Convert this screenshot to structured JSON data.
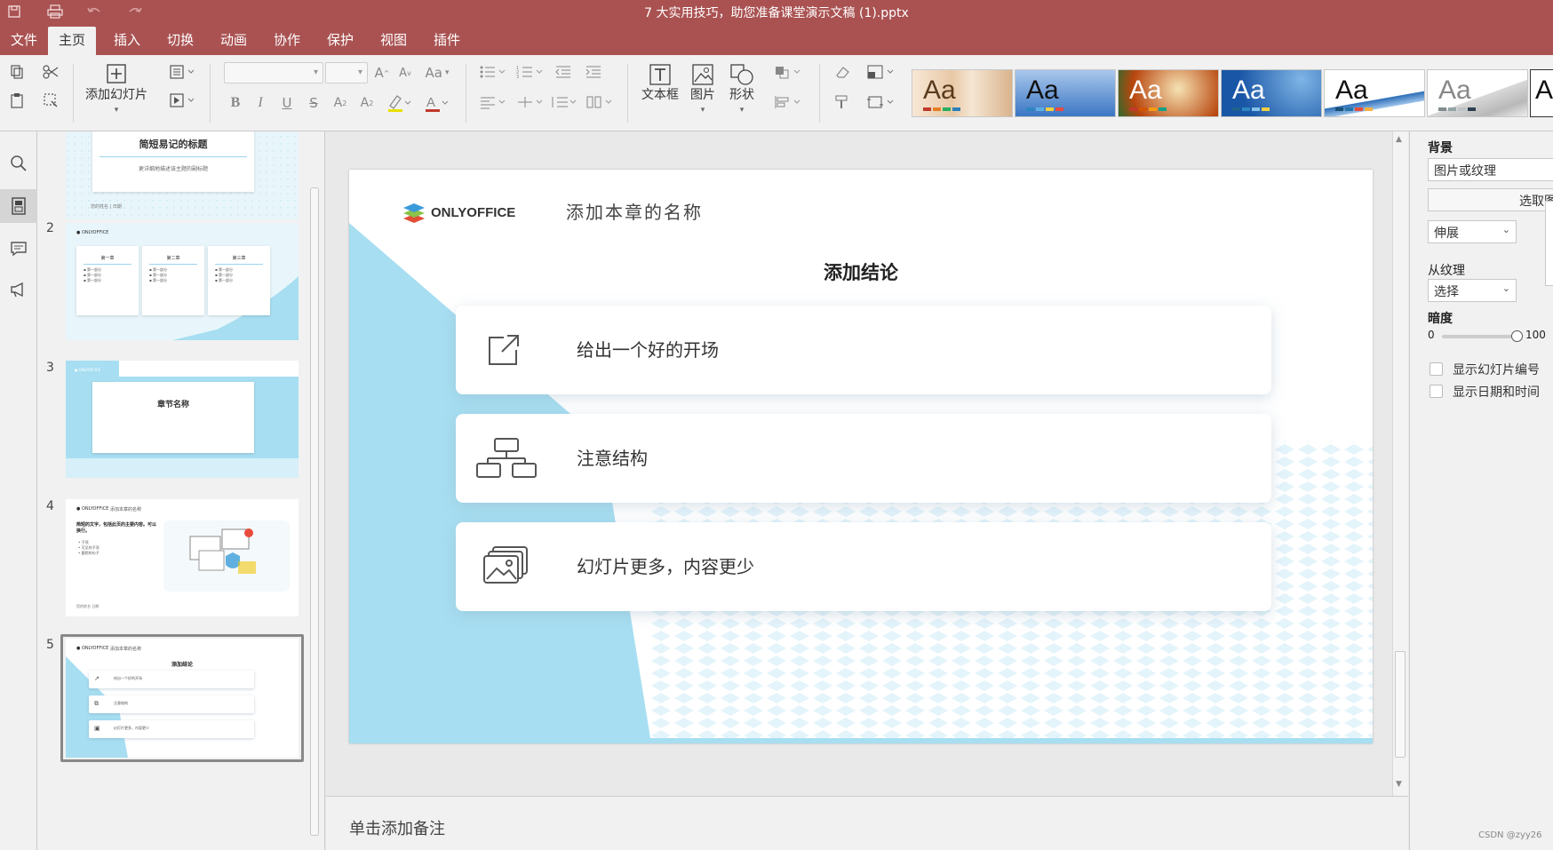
{
  "app": {
    "document_title": "7 大实用技巧，助您准备课堂演示文稿 (1).pptx",
    "accent_color": "#aa5252"
  },
  "quick_access": [
    {
      "icon": "save-icon"
    },
    {
      "icon": "print-icon"
    },
    {
      "icon": "undo-icon"
    },
    {
      "icon": "redo-icon"
    }
  ],
  "menu_tabs": [
    "文件",
    "主页",
    "插入",
    "切换",
    "动画",
    "协作",
    "保护",
    "视图",
    "插件"
  ],
  "active_tab": "主页",
  "toolbar": {
    "add_slide_label": "添加幻灯片",
    "textbox_label": "文本框",
    "image_label": "图片",
    "shape_label": "形状",
    "font_case_label": "Aa",
    "themes": [
      {
        "name": "Aa",
        "colors": [
          "#c0392b",
          "#e67e22",
          "#27ae60",
          "#2980b9"
        ]
      },
      {
        "name": "Aa",
        "colors": [
          "#2e86c1",
          "#5dade2",
          "#f4d03f",
          "#e74c3c"
        ]
      },
      {
        "name": "Aa",
        "colors": [
          "#c0392b",
          "#d35400",
          "#f39c12",
          "#16a085"
        ]
      },
      {
        "name": "Aa",
        "colors": [
          "#1f618d",
          "#2e86c1",
          "#85c1e9",
          "#f4d03f"
        ]
      },
      {
        "name": "Aa",
        "colors": [
          "#1a5276",
          "#2874a6",
          "#e74c3c",
          "#f5b041"
        ]
      },
      {
        "name": "Aa",
        "colors": [
          "#7f8c8d",
          "#95a5a6",
          "#bdc3c7",
          "#2c3e50"
        ]
      },
      {
        "name": "A",
        "colors": []
      }
    ]
  },
  "slides_panel": {
    "slides": [
      {
        "number": "",
        "title": "简短易记的标题",
        "subtitle": "更详细地描述该主题的副标题",
        "footer": "您的姓名 | 日期"
      },
      {
        "number": "2",
        "col1": "第一章",
        "col2": "第二章",
        "col3": "第三章",
        "bullet": "第一部分"
      },
      {
        "number": "3",
        "title": "章节名称"
      },
      {
        "number": "4",
        "heading": "简短的文字，包括此页的主要内容。可以换行。",
        "bullets": [
          "子项",
          "可见的子项",
          "跟踪的句子"
        ],
        "header": "添加本章的名称",
        "footer": "您的姓名 日期"
      },
      {
        "number": "5",
        "header": "添加本章的名称",
        "title": "添加结论",
        "items": [
          "给出一个好的开场",
          "注意结构",
          "幻灯片更多，内容更少"
        ]
      }
    ]
  },
  "slide": {
    "logo_text": "ONLYOFFICE",
    "chapter_name": "添加本章的名称",
    "title": "添加结论",
    "cards": [
      {
        "icon": "external-link-icon",
        "text": "给出一个好的开场"
      },
      {
        "icon": "hierarchy-icon",
        "text": "注意结构"
      },
      {
        "icon": "images-icon",
        "text": "幻灯片更多，内容更少"
      }
    ],
    "accent_color": "#a7def1"
  },
  "notes_placeholder": "单击添加备注",
  "right_panel": {
    "background_label": "背景",
    "fill_type": "图片或纹理",
    "select_image_button": "选取图片",
    "stretch_value": "伸展",
    "from_texture_label": "从纹理",
    "select_value": "选择",
    "darkness_label": "暗度",
    "darkness_min": "0",
    "darkness_max": "100",
    "darkness_value": 100,
    "show_slide_number": "显示幻灯片编号",
    "show_date_time": "显示日期和时间"
  },
  "watermark": "CSDN @zyy26"
}
